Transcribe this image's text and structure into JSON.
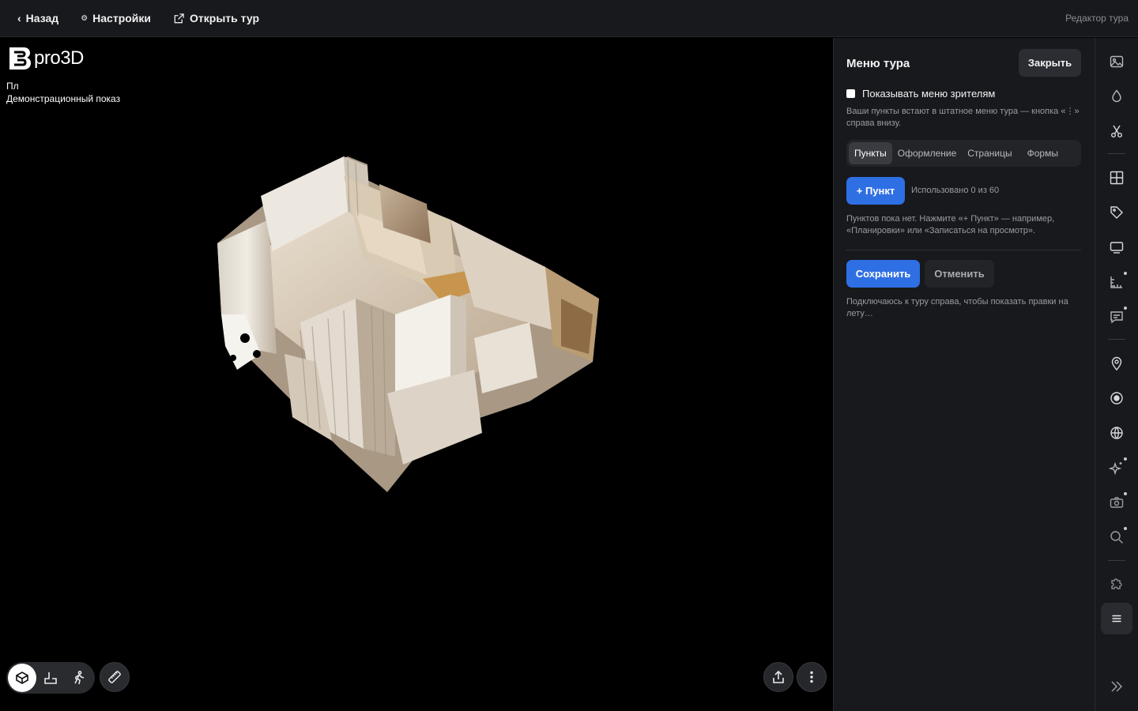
{
  "topbar": {
    "back_label": "Назад",
    "settings_label": "Настройки",
    "open_tour_label": "Открыть тур",
    "editor_label": "Редактор тура"
  },
  "viewer": {
    "logo_text": "pro3D",
    "tour_short": "Пл",
    "tour_name": "Демонстрационный показ",
    "view_modes": [
      "dollhouse-icon",
      "floorplan-icon",
      "walk-icon"
    ],
    "active_mode": "dollhouse-icon"
  },
  "panel": {
    "title": "Меню тура",
    "close_label": "Закрыть",
    "show_menu_label": "Показывать меню зрителям",
    "show_menu_checked": false,
    "show_menu_hint": "Ваши пункты встают в штатное меню тура — кнопка «⋮» справа внизу.",
    "tabs": [
      {
        "label": "Пункты",
        "active": true
      },
      {
        "label": "Оформление",
        "active": false
      },
      {
        "label": "Страницы",
        "active": false
      },
      {
        "label": "Формы",
        "active": false
      }
    ],
    "add_label": "+ Пункт",
    "used_label": "Использовано 0 из 60",
    "empty_hint": "Пунктов пока нет. Нажмите «+ Пункт» — например, «Планировки» или «Записаться на просмотр».",
    "save_label": "Сохранить",
    "cancel_label": "Отменить",
    "status_text": "Подключаюсь к туру справа, чтобы показать правки на лету…"
  },
  "rail": {
    "icons": [
      "image-icon",
      "drop-icon",
      "scissors-icon",
      "grid-icon",
      "tag-icon",
      "screen-icon",
      "measure-plan-icon",
      "comment-icon",
      "pin-icon",
      "target-icon",
      "globe-icon",
      "sparkle-icon",
      "camera-icon",
      "search-icon",
      "puzzle-icon",
      "menu-icon",
      "expand-icon"
    ],
    "active_icon": "menu-icon"
  },
  "colors": {
    "accent": "#2f6fe4",
    "panel_bg": "#18191c",
    "viewer_bg": "#000000"
  }
}
